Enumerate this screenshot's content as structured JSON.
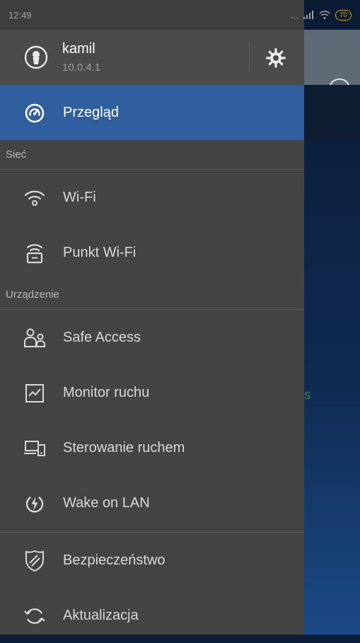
{
  "status_bar": {
    "time": "12:49",
    "dots": "...",
    "battery": "70"
  },
  "header": {
    "user_name": "kamil",
    "ip": "10.0.4.1"
  },
  "menu": {
    "overview": "Przegląd",
    "section_network": "Sieć",
    "wifi": "Wi-Fi",
    "hotspot": "Punkt Wi-Fi",
    "section_device": "Urządzenie",
    "safe_access": "Safe Access",
    "traffic_monitor": "Monitor ruchu",
    "traffic_control": "Sterowanie ruchem",
    "wake_on_lan": "Wake on LAN",
    "security": "Bezpieczeństwo",
    "update": "Aktualizacja"
  },
  "background": {
    "partial_text": "s"
  },
  "colors": {
    "active": "#2f5f9f",
    "drawer": "#444444",
    "header": "#4b4b4b",
    "battery": "#c8a800"
  }
}
